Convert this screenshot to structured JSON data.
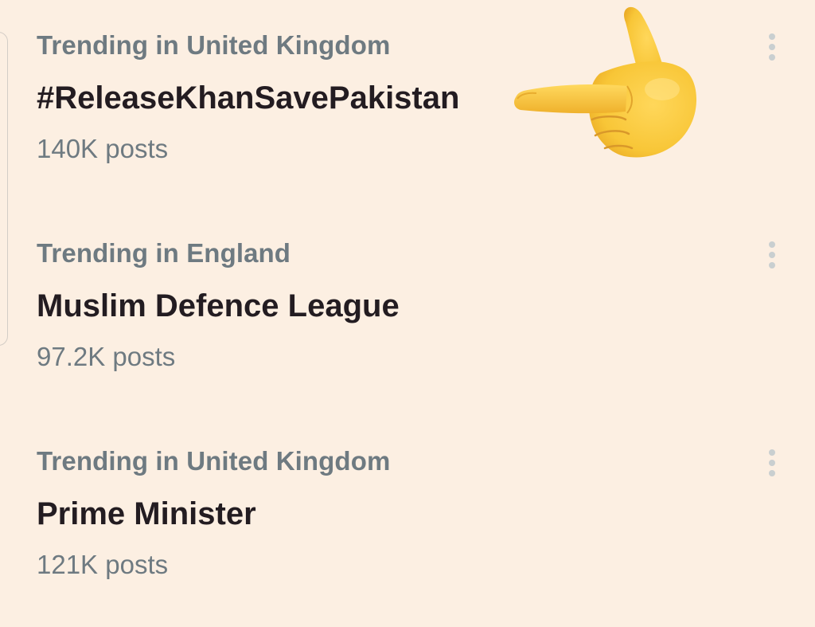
{
  "trends": [
    {
      "context": "Trending in United Kingdom",
      "title": "#ReleaseKhanSavePakistan",
      "count": "140K posts"
    },
    {
      "context": "Trending in England",
      "title": "Muslim Defence League",
      "count": "97.2K posts"
    },
    {
      "context": "Trending in United Kingdom",
      "title": "Prime Minister",
      "count": "121K posts"
    }
  ],
  "icons": {
    "more": "more-options-icon",
    "pointer": "backhand-index-pointing-left-icon"
  },
  "colors": {
    "background": "#FCEFE2",
    "title": "#231C21",
    "secondary": "#6E7A81",
    "dots": "#C9CFD0",
    "emoji": "#F8C637"
  }
}
